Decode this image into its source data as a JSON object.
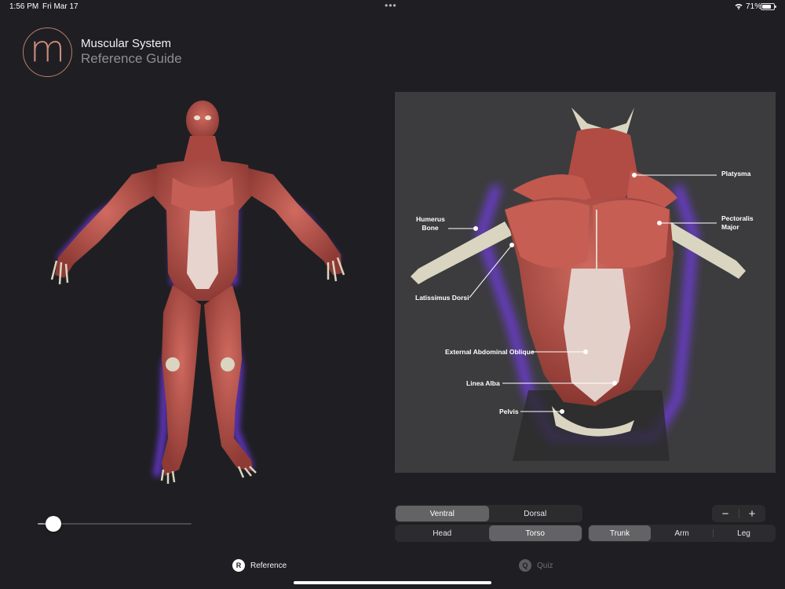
{
  "status_bar": {
    "time": "1:56 PM",
    "date": "Fri Mar 17",
    "dots": "•••",
    "battery_percent": "71%",
    "battery_level": 0.71
  },
  "header": {
    "logo_letter": "m",
    "title": "Muscular System",
    "subtitle": "Reference Guide"
  },
  "slider": {
    "value": 0.1
  },
  "detail": {
    "labels": {
      "platysma": "Platysma",
      "humerus_line1": "Humerus",
      "humerus_line2": "Bone",
      "pectoralis_line1": "Pectoralis",
      "pectoralis_line2": "Major",
      "latissimus": "Latissimus Dorsi",
      "external_oblique": "External Abdominal Oblique",
      "linea_alba": "Linea Alba",
      "pelvis": "Pelvis"
    }
  },
  "controls": {
    "view": [
      "Ventral",
      "Dorsal"
    ],
    "view_selected": "Ventral",
    "region": [
      "Head",
      "Torso"
    ],
    "region_selected": "Torso",
    "part": [
      "Trunk",
      "Arm",
      "Leg"
    ],
    "part_selected": "Trunk",
    "zoom_out": "−",
    "zoom_in": "+"
  },
  "tabs": {
    "reference_icon": "R",
    "reference_label": "Reference",
    "quiz_icon": "Q",
    "quiz_label": "Quiz"
  },
  "colors": {
    "background": "#1f1f23",
    "accent_logo": "#c07a6e",
    "muscle": "#b5524a",
    "bone": "#d9d5c0",
    "glow": "#7b3cff"
  }
}
